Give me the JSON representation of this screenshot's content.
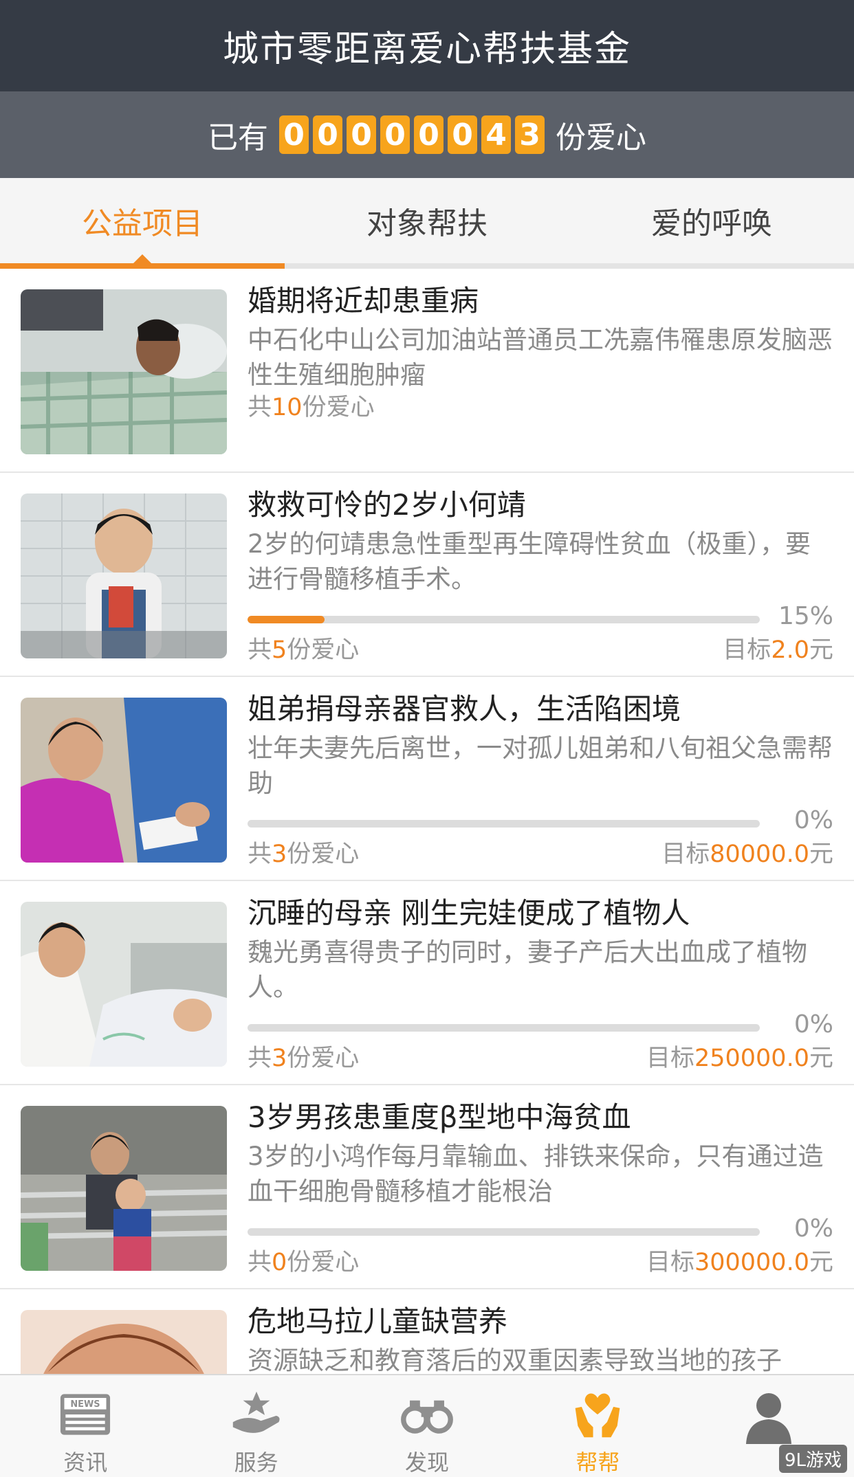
{
  "header": {
    "title": "城市零距离爱心帮扶基金",
    "counter_prefix": "已有",
    "counter_digits": [
      "0",
      "0",
      "0",
      "0",
      "0",
      "0",
      "4",
      "3"
    ],
    "counter_suffix": "份爱心"
  },
  "tabs": [
    {
      "label": "公益项目",
      "active": true
    },
    {
      "label": "对象帮扶",
      "active": false
    },
    {
      "label": "爱的呼唤",
      "active": false
    }
  ],
  "projects": [
    {
      "title": "婚期将近却患重病",
      "desc": "中石化中山公司加油站普通员工冼嘉伟罹患原发脑恶性生殖细胞肿瘤",
      "love_prefix": "共",
      "love_count": "10",
      "love_suffix": "份爱心",
      "has_progress": false
    },
    {
      "title": "救救可怜的2岁小何靖",
      "desc": "2岁的何靖患急性重型再生障碍性贫血（极重），要进行骨髓移植手术。",
      "love_prefix": "共",
      "love_count": "5",
      "love_suffix": "份爱心",
      "has_progress": true,
      "percent_label": "15%",
      "progress": 0.15,
      "target_prefix": "目标",
      "target_value": "2.0",
      "target_suffix": "元"
    },
    {
      "title": "姐弟捐母亲器官救人，生活陷困境",
      "desc": "壮年夫妻先后离世，一对孤儿姐弟和八旬祖父急需帮助",
      "love_prefix": "共",
      "love_count": "3",
      "love_suffix": "份爱心",
      "has_progress": true,
      "percent_label": "0%",
      "progress": 0,
      "target_prefix": "目标",
      "target_value": "80000.0",
      "target_suffix": "元"
    },
    {
      "title": "沉睡的母亲 刚生完娃便成了植物人",
      "desc": "魏光勇喜得贵子的同时，妻子产后大出血成了植物人。",
      "love_prefix": "共",
      "love_count": "3",
      "love_suffix": "份爱心",
      "has_progress": true,
      "percent_label": "0%",
      "progress": 0,
      "target_prefix": "目标",
      "target_value": "250000.0",
      "target_suffix": "元"
    },
    {
      "title": "3岁男孩患重度β型地中海贫血",
      "desc": "3岁的小鸿作每月靠输血、排铁来保命，只有通过造血干细胞骨髓移植才能根治",
      "love_prefix": "共",
      "love_count": "0",
      "love_suffix": "份爱心",
      "has_progress": true,
      "percent_label": "0%",
      "progress": 0,
      "target_prefix": "目标",
      "target_value": "300000.0",
      "target_suffix": "元"
    },
    {
      "title": "危地马拉儿童缺营养",
      "desc": "资源缺乏和教育落后的双重因素导致当地的孩子",
      "has_progress": false
    }
  ],
  "nav": [
    {
      "label": "资讯",
      "icon": "news-icon",
      "active": false
    },
    {
      "label": "服务",
      "icon": "service-hand-star-icon",
      "active": false
    },
    {
      "label": "发现",
      "icon": "binoculars-icon",
      "active": false
    },
    {
      "label": "帮帮",
      "icon": "helping-hands-heart-icon",
      "active": true
    },
    {
      "label": "",
      "icon": "user-profile-icon",
      "active": false
    }
  ],
  "watermark": "9L游戏",
  "colors": {
    "accent": "#f08a24",
    "header_bg": "#353b45",
    "counter_bg": "#5b6069",
    "digit_bg": "#f7a41c"
  }
}
